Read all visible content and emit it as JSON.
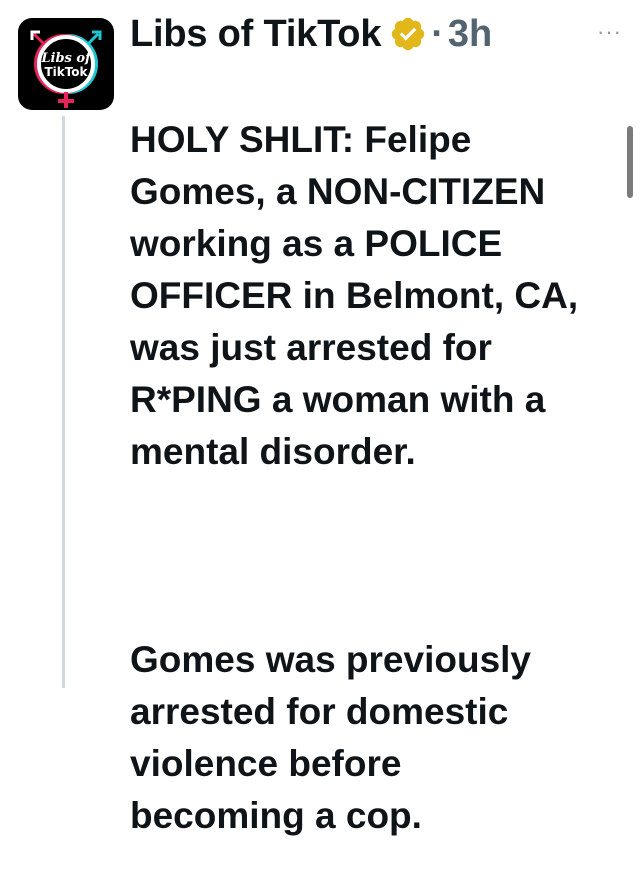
{
  "tweet": {
    "author_name": "Libs of TikTok",
    "verified_icon": "verified-gold-badge-icon",
    "separator": "·",
    "timestamp": "3h",
    "more_label": "···",
    "avatar": {
      "logo_text_top": "Libs of",
      "logo_text_bottom": "TikTok",
      "colors": {
        "background": "#000000",
        "ring_pink": "#e6245b",
        "ring_teal": "#1fc7d4",
        "text": "#ffffff"
      }
    },
    "paragraphs": [
      "HOLY SHLIT: Felipe\nGomes, a NON-CITIZEN\nworking as a POLICE\nOFFICER in Belmont, CA,\nwas just arrested for\nR*PING a woman with a\nmental disorder.",
      "Gomes was previously\narrested for domestic\nviolence before\nbecoming a cop."
    ]
  },
  "colors": {
    "text": "#0f1419",
    "secondary": "#536471",
    "thread_line": "#cfd9de",
    "verified_gold": "#e2b719"
  }
}
